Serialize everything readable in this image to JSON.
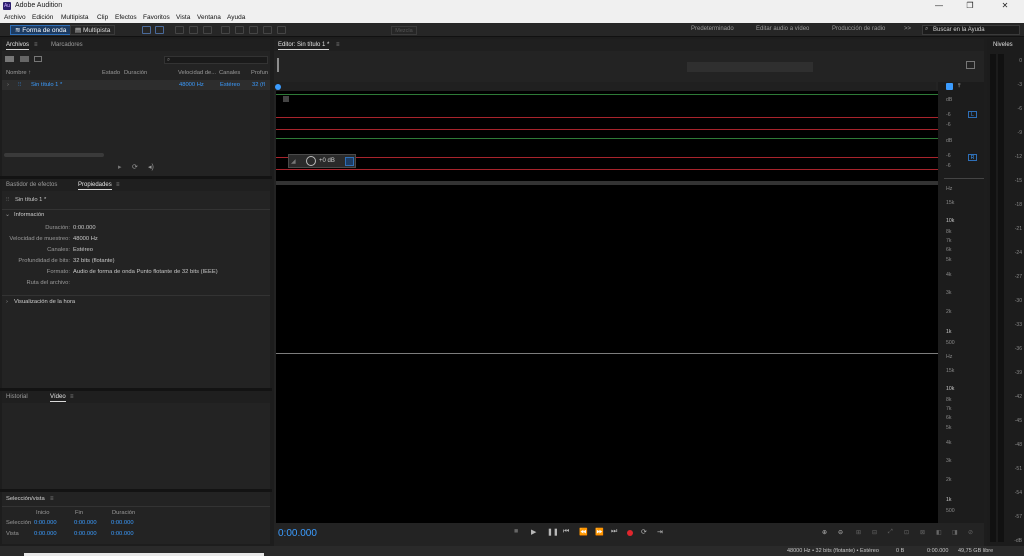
{
  "app": {
    "logo": "Au",
    "title": "Adobe Audition"
  },
  "window_controls": [
    "—",
    "❐",
    "✕"
  ],
  "menu": [
    "Archivo",
    "Edición",
    "Multipista",
    "Clip",
    "Efectos",
    "Favoritos",
    "Vista",
    "Ventana",
    "Ayuda"
  ],
  "toolbar": {
    "waveform_label": "Forma de onda",
    "multitrack_label": "Multipista",
    "blend_label": "Mezcla",
    "workspaces": [
      "Predeterminado",
      "Editar audio a vídeo",
      "Producción de radio"
    ],
    "more": ">>",
    "search_placeholder": "Buscar en la Ayuda"
  },
  "files_panel": {
    "tabs": [
      "Archivos",
      "Marcadores"
    ],
    "columns": [
      "Nombre ↑",
      "Estado",
      "Duración",
      "Velocidad de...",
      "Canales",
      "Profun"
    ],
    "row": {
      "name": "Sin título 1 *",
      "rate": "48000 Hz",
      "channels": "Estéreo",
      "depth": "32 (fl"
    }
  },
  "properties_panel": {
    "tabs": [
      "Bastidor de efectos",
      "Propiedades"
    ],
    "file": "Sin título 1 *",
    "section_info": "Información",
    "fields": [
      {
        "label": "Duración:",
        "value": "0:00.000"
      },
      {
        "label": "Velocidad de muestreo:",
        "value": "48000 Hz"
      },
      {
        "label": "Canales:",
        "value": "Estéreo"
      },
      {
        "label": "Profundidad de bits:",
        "value": "32 bits (flotante)"
      },
      {
        "label": "Formato:",
        "value": "Audio de forma de onda Punto flotante de 32 bits (IEEE)"
      },
      {
        "label": "Ruta del archivo:",
        "value": ""
      }
    ],
    "section_time": "Visualización de la hora"
  },
  "history_panel": {
    "tabs": [
      "Historial",
      "Vídeo"
    ]
  },
  "selection_panel": {
    "title": "Selección/vista",
    "headers": [
      "Inicio",
      "Fin",
      "Duración"
    ],
    "rows": [
      {
        "label": "Selección",
        "values": [
          "0:00.000",
          "0:00.000",
          "0:00.000"
        ]
      },
      {
        "label": "Vista",
        "values": [
          "0:00.000",
          "0:00.000",
          "0:00.000"
        ]
      }
    ]
  },
  "editor": {
    "title": "Editor: Sin título 1 *",
    "hud_gain": "+0 dB",
    "timecode": "0:00.000",
    "db_scale_1": [
      "dB",
      "-6",
      "-6"
    ],
    "db_scale_2": [
      "dB",
      "-6",
      "-6"
    ],
    "channel_badges": [
      "L",
      "R"
    ],
    "freq_scale": [
      "Hz",
      "15k",
      "10k",
      "8k",
      "7k",
      "6k",
      "5k",
      "4k",
      "3k",
      "2k",
      "1k",
      "500"
    ]
  },
  "levels": {
    "title": "Niveles",
    "ticks": [
      "0",
      "-3",
      "-6",
      "-9",
      "-12",
      "-15",
      "-18",
      "-21",
      "-24",
      "-27",
      "-30",
      "-33",
      "-36",
      "-39",
      "-42",
      "-45",
      "-48",
      "-51",
      "-54",
      "-57",
      "-dB"
    ]
  },
  "status": {
    "items": [
      "48000 Hz • 32 bits (flotante) • Estéreo",
      "0 B",
      "0:00.000",
      "49,75 GB libre"
    ]
  },
  "colors": {
    "accent": "#2e6fb8",
    "link": "#3b9cff",
    "red": "#a8242c",
    "record": "#e0262d"
  }
}
